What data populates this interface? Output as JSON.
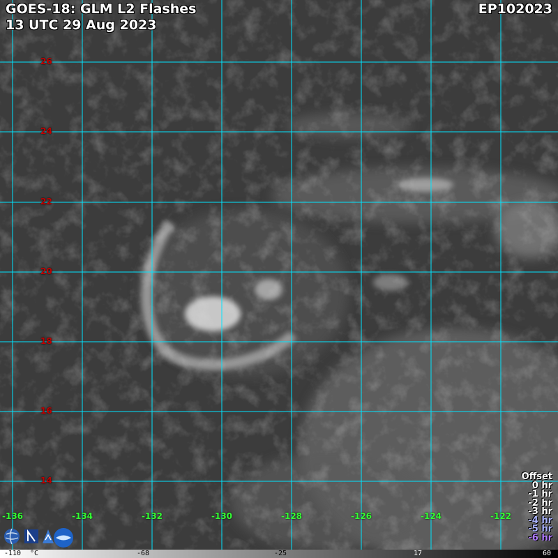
{
  "header": {
    "title": "GOES-18: GLM L2 Flashes",
    "time": "13 UTC 29 Aug 2023",
    "storm_id": "EP102023"
  },
  "grid": {
    "latitudes": [
      "26",
      "24",
      "22",
      "20",
      "18",
      "16",
      "14"
    ],
    "longitudes": [
      "-136",
      "-134",
      "-132",
      "-130",
      "-128",
      "-126",
      "-124",
      "-122"
    ],
    "line_color": "#00e5ff",
    "lat_label_color": "#c00000",
    "lon_label_color": "#33ff33"
  },
  "offset_legend": {
    "title": "Offset",
    "entries": [
      {
        "label": "0 hr",
        "color": "#ffffff"
      },
      {
        "label": "-1 hr",
        "color": "#ffffff"
      },
      {
        "label": "-2 hr",
        "color": "#ffffff"
      },
      {
        "label": "-3 hr",
        "color": "#ffffff"
      },
      {
        "label": "-4 hr",
        "color": "#aab4ff"
      },
      {
        "label": "-5 hr",
        "color": "#aab4ff"
      },
      {
        "label": "-6 hr",
        "color": "#b07cff"
      }
    ]
  },
  "colorbar": {
    "labels": [
      "-110",
      "°C",
      "-68",
      "-25",
      "17",
      "60"
    ]
  },
  "logos": [
    "globe-logo",
    "cira-logo",
    "rammb-logo"
  ]
}
